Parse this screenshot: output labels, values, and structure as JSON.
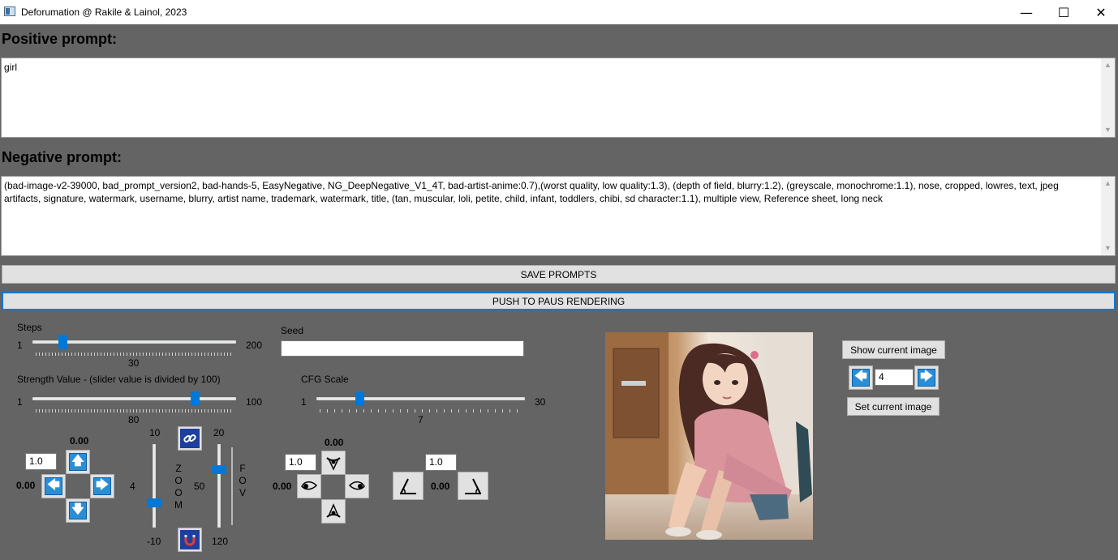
{
  "window": {
    "title": "Deforumation @ Rakile & Lainol, 2023",
    "minimize_glyph": "—",
    "maximize_glyph": "☐",
    "close_glyph": "✕"
  },
  "positive": {
    "heading": "Positive prompt:",
    "value": "girl"
  },
  "negative": {
    "heading": "Negative prompt:",
    "value": "(bad-image-v2-39000, bad_prompt_version2, bad-hands-5, EasyNegative, NG_DeepNegative_V1_4T, bad-artist-anime:0.7),(worst quality, low quality:1.3), (depth of field, blurry:1.2), (greyscale, monochrome:1.1), nose, cropped, lowres, text, jpeg artifacts, signature, watermark, username, blurry, artist name, trademark, watermark, title, (tan, muscular, loli, petite, child, infant, toddlers, chibi, sd character:1.1), multiple view, Reference sheet, long neck"
  },
  "buttons": {
    "save_prompts": "SAVE PROMPTS",
    "pause_rendering": "PUSH TO PAUS RENDERING",
    "show_current_image": "Show current image",
    "set_current_image": "Set current image"
  },
  "steps": {
    "label": "Steps",
    "min": "1",
    "max": "200",
    "value": "30",
    "fraction": 0.146
  },
  "seed": {
    "label": "Seed",
    "value": ""
  },
  "strength": {
    "label": "Strength Value - (slider value is divided by 100)",
    "min": "1",
    "max": "100",
    "value": "80",
    "fraction": 0.798
  },
  "cfg": {
    "label": "CFG Scale",
    "min": "1",
    "max": "30",
    "value": "7",
    "fraction": 0.207
  },
  "pan": {
    "step": "1.0",
    "y_value": "0.00",
    "x_value": "0.00"
  },
  "zoom": {
    "word": "ZOOM",
    "top": "10",
    "bottom": "-10",
    "value": "4",
    "fraction": 0.7
  },
  "fov": {
    "word": "FOV",
    "top": "20",
    "bottom": "120",
    "value": "50",
    "fraction": 0.3
  },
  "rotation": {
    "step": "1.0",
    "y_value": "0.00",
    "x_value": "0.00"
  },
  "tilt": {
    "step": "1.0",
    "value": "0.00"
  },
  "image_nav": {
    "index": "4"
  },
  "icons": {
    "arrow_up": "🡅",
    "arrow_down": "🡇",
    "arrow_left": "🡄",
    "arrow_right": "🡆"
  },
  "colors": {
    "accent": "#0078d7",
    "background": "#646464",
    "arrow_tile": "#2a8ed6"
  }
}
